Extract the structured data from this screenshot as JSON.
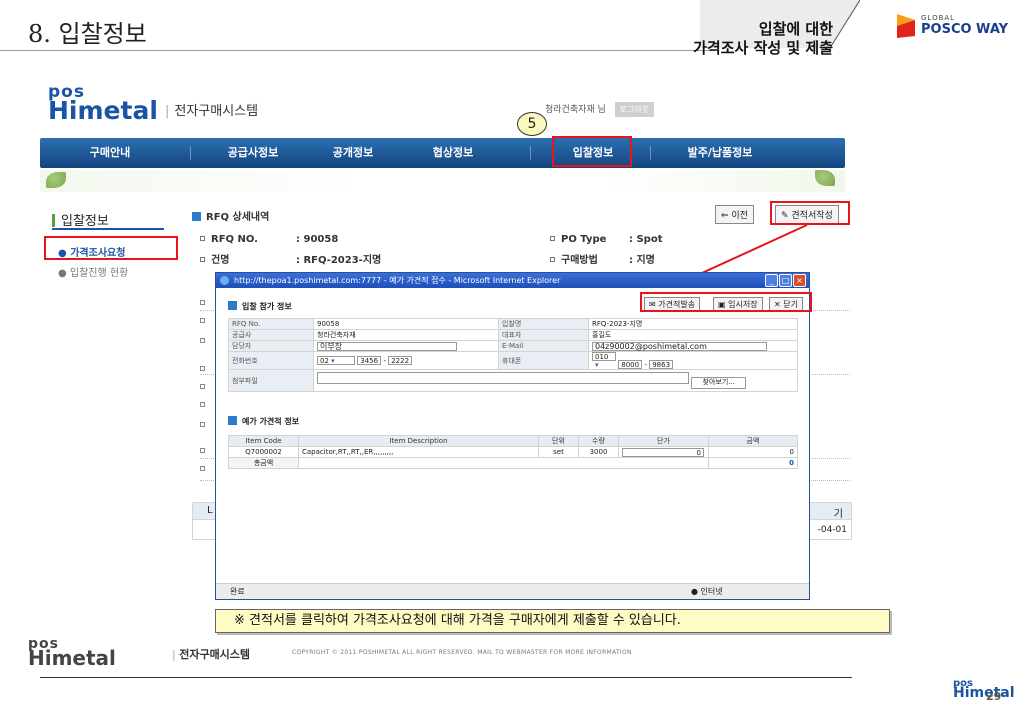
{
  "slide": {
    "title": "8. 입찰정보",
    "caption_line1": "입찰에 대한",
    "caption_line2": "가격조사 작성 및 제출",
    "brand_small": "GLOBAL",
    "brand_big": "POSCO WAY",
    "page_number": "29"
  },
  "app": {
    "logo_pos": "pos",
    "logo_himetal": "Himetal",
    "system_name": "전자구매시스템",
    "user_name": "청라건축자재 님",
    "logout": "로그아웃",
    "step_number": "5"
  },
  "nav": {
    "items": [
      "구매안내",
      "공급사정보",
      "공개정보",
      "협상정보",
      "입찰정보",
      "발주/납품정보"
    ]
  },
  "sidebar": {
    "title": "입찰정보",
    "items": [
      "가격조사요청",
      "입찰진행 현황"
    ]
  },
  "rfq": {
    "section_title": "RFQ 상세내역",
    "prev_button": "이전",
    "quote_button": "견적서작성",
    "rfq_no_label": "RFQ NO.",
    "rfq_no_value": ": 90058",
    "name_label": "건명",
    "name_value": ": RFQ-2023-지명",
    "po_type_label": "PO Type",
    "po_type_value": ": Spot",
    "method_label": "구매방법",
    "method_value": ": 지명",
    "right_fragment1": "기",
    "right_fragment2": "-04-01",
    "left_fragment": "L"
  },
  "popup": {
    "title": "http://thepoa1.poshimetal.com:7777 - 예가 가견적 접수 - Microsoft Internet Explorer",
    "section1": "입찰 참가 정보",
    "btn_submit": "가견적발송",
    "btn_temp_save": "임시저장",
    "btn_close": "닫기",
    "form": {
      "rfq_no_label": "RFQ No.",
      "rfq_no_value": "90058",
      "bid_name_label": "입찰명",
      "bid_name_value": "RFQ-2023-지명",
      "supplier_label": "공급사",
      "supplier_value": "청라건축자재",
      "ceo_label": "대표자",
      "ceo_value": "홍길도",
      "manager_label": "담당자",
      "manager_value": "이부장",
      "email_label": "E-Mail",
      "email_value": "04z90002@poshimetal.com",
      "phone_label": "전화번호",
      "phone_area": "02",
      "phone_mid": "3456",
      "phone_last": "2222",
      "mobile_label": "휴대폰",
      "mobile_area": "010",
      "mobile_mid": "8000",
      "mobile_last": "9863",
      "attach_label": "첨부파일",
      "browse_button": "찾아보기..."
    },
    "section2": "예가 가견적 정보",
    "items_headers": [
      "Item Code",
      "Item Description",
      "단위",
      "수량",
      "단가",
      "금액"
    ],
    "items_rows": [
      {
        "code": "Q7000002",
        "desc": "Capacitor,RT,,RT,,ER,,,,,,,,,",
        "unit": "set",
        "qty": "3000",
        "price": "0",
        "amount": "0"
      }
    ],
    "total_label": "총금액",
    "total_value": "0",
    "status_left": "완료",
    "status_right": "인터넷"
  },
  "callout": "※ 견적서를 클릭하여 가격조사요청에 대해 가격을 구매자에게 제출할 수 있습니다.",
  "footer": {
    "logo_pos": "pos",
    "logo_himetal": "Himetal",
    "system_name": "전자구매시스템",
    "copyright": "COPYRIGHT © 2011 POSHIMETAL ALL RIGHT RESERVED. MAIL TO WEBMASTER FOR MORE INFORMATION"
  }
}
